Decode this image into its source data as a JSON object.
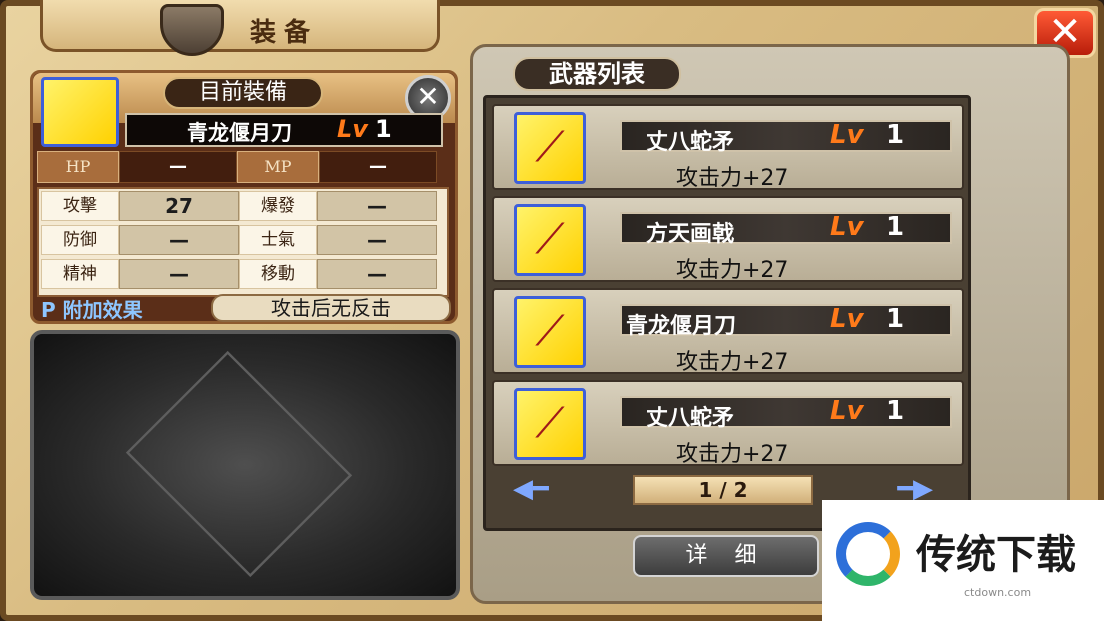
{
  "window": {
    "title": "装备",
    "close_label": "✕"
  },
  "current_equipment": {
    "header": "目前裝備",
    "close_label": "✕",
    "weapon_name": "青龙偃月刀",
    "lv_label": "Lv",
    "lv_value": "1",
    "hp_label": "HP",
    "hp_value": "—",
    "mp_label": "MP",
    "mp_value": "—",
    "stats": [
      {
        "label_a": "攻擊",
        "value_a": "27",
        "label_b": "爆發",
        "value_b": "—"
      },
      {
        "label_a": "防御",
        "value_a": "—",
        "label_b": "士氣",
        "value_b": "—"
      },
      {
        "label_a": "精神",
        "value_a": "—",
        "label_b": "移動",
        "value_b": "—"
      }
    ],
    "effect_label": "P 附加效果",
    "effect_value": "攻击后无反击"
  },
  "weapon_list": {
    "title": "武器列表",
    "items": [
      {
        "name": "丈八蛇矛",
        "lv_label": "Lv",
        "lv": "1",
        "attack": "攻击力+27"
      },
      {
        "name": "方天画戟",
        "lv_label": "Lv",
        "lv": "1",
        "attack": "攻击力+27"
      },
      {
        "name": "青龙偃月刀",
        "lv_label": "Lv",
        "lv": "1",
        "attack": "攻击力+27"
      },
      {
        "name": "丈八蛇矛",
        "lv_label": "Lv",
        "lv": "1",
        "attack": "攻击力+27"
      }
    ],
    "page": "1 / 2",
    "detail_label": "详 细"
  },
  "watermark": {
    "text": "传统下载",
    "sub": "ctdown.com"
  },
  "icons": {
    "weapon": "spear-icon",
    "prev": "arrow-left-icon",
    "next": "arrow-right-icon"
  }
}
